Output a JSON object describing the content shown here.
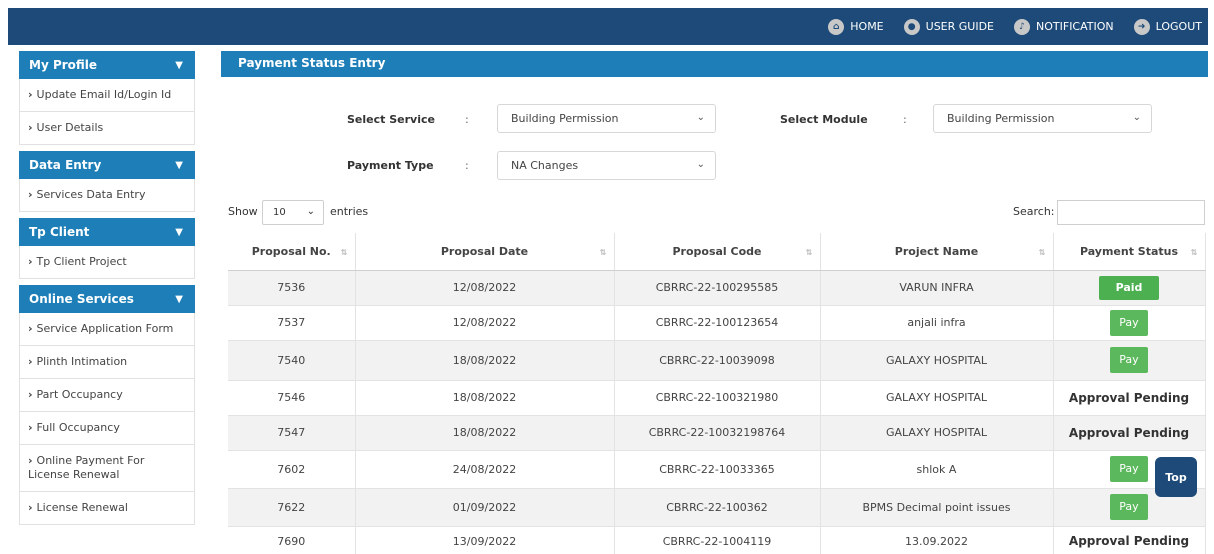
{
  "topnav": [
    {
      "label": "HOME",
      "icon": "home-icon"
    },
    {
      "label": "USER GUIDE",
      "icon": "user-icon"
    },
    {
      "label": "NOTIFICATION",
      "icon": "bell-icon"
    },
    {
      "label": "LOGOUT",
      "icon": "logout-icon"
    }
  ],
  "sidebar": {
    "sections": [
      {
        "title": "My Profile",
        "items": [
          "Update Email Id/Login Id",
          "User Details"
        ]
      },
      {
        "title": "Data Entry",
        "items": [
          "Services Data Entry"
        ]
      },
      {
        "title": "Tp Client",
        "items": [
          "Tp Client Project"
        ]
      },
      {
        "title": "Online Services",
        "items": [
          "Service Application Form",
          "Plinth Intimation",
          "Part Occupancy",
          "Full Occupancy",
          "Online Payment For License Renewal",
          "License Renewal"
        ]
      }
    ]
  },
  "panel": {
    "title": "Payment Status Entry",
    "select_service_label": "Select Service",
    "select_service_value": "Building Permission",
    "select_module_label": "Select Module",
    "select_module_value": "Building Permission",
    "payment_type_label": "Payment Type",
    "payment_type_value": "NA Changes",
    "colon": ":"
  },
  "table_controls": {
    "show": "Show",
    "page_length": "10",
    "entries": "entries",
    "search": "Search:"
  },
  "table": {
    "headers": [
      "Proposal No.",
      "Proposal Date",
      "Proposal Code",
      "Project Name",
      "Payment Status"
    ],
    "rows": [
      {
        "no": "7536",
        "date": "12/08/2022",
        "code": "CBRRC-22-100295585",
        "project": "VARUN INFRA",
        "status": "Paid",
        "kind": "paid"
      },
      {
        "no": "7537",
        "date": "12/08/2022",
        "code": "CBRRC-22-100123654",
        "project": "anjali infra",
        "status": "Pay",
        "kind": "pay"
      },
      {
        "no": "7540",
        "date": "18/08/2022",
        "code": "CBRRC-22-10039098",
        "project": "GALAXY HOSPITAL",
        "status": "Pay",
        "kind": "pay"
      },
      {
        "no": "7546",
        "date": "18/08/2022",
        "code": "CBRRC-22-100321980",
        "project": "GALAXY HOSPITAL",
        "status": "Approval Pending",
        "kind": "pending"
      },
      {
        "no": "7547",
        "date": "18/08/2022",
        "code": "CBRRC-22-10032198764",
        "project": "GALAXY HOSPITAL",
        "status": "Approval Pending",
        "kind": "pending"
      },
      {
        "no": "7602",
        "date": "24/08/2022",
        "code": "CBRRC-22-10033365",
        "project": "shlok A",
        "status": "Pay",
        "kind": "pay"
      },
      {
        "no": "7622",
        "date": "01/09/2022",
        "code": "CBRRC-22-100362",
        "project": "BPMS Decimal point issues",
        "status": "Pay",
        "kind": "pay"
      },
      {
        "no": "7690",
        "date": "13/09/2022",
        "code": "CBRRC-22-1004119",
        "project": "13.09.2022",
        "status": "Approval Pending",
        "kind": "pending"
      }
    ]
  },
  "top_button": "Top"
}
